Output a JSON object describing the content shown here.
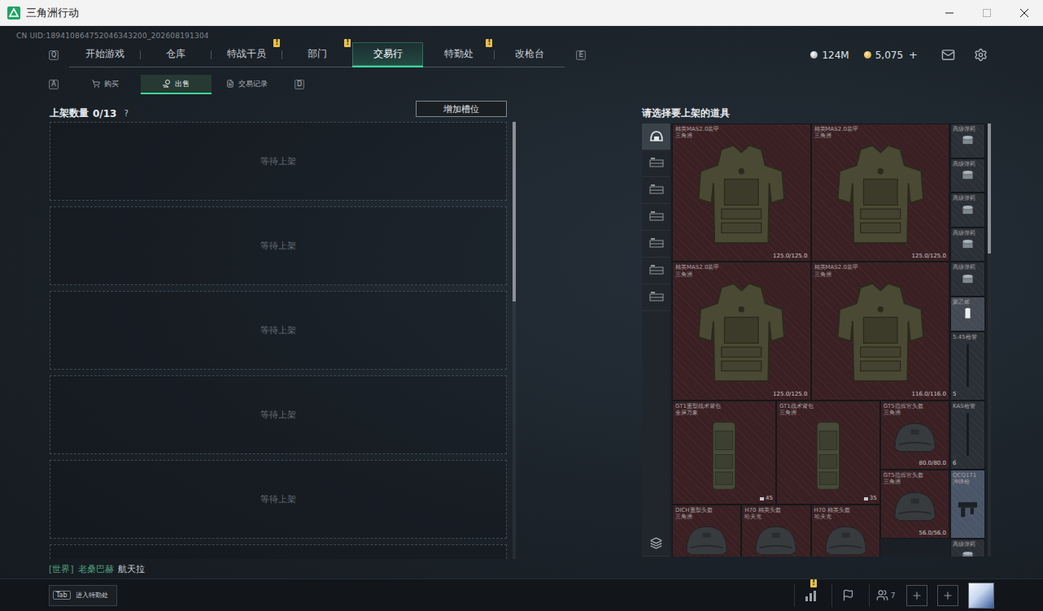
{
  "window": {
    "title": "三角洲行动",
    "controls": [
      {
        "kind": "minimize",
        "disabled": false
      },
      {
        "kind": "maximize",
        "disabled": true
      },
      {
        "kind": "close",
        "disabled": false
      }
    ]
  },
  "uid": "CN UID:189410864752046343200_202608191304",
  "nav": {
    "prev_key": "Q",
    "next_key": "E",
    "tabs": [
      {
        "label": "开始游戏",
        "selected": false,
        "badge": ""
      },
      {
        "label": "仓库",
        "selected": false,
        "badge": ""
      },
      {
        "label": "特战干员",
        "selected": false,
        "badge": "!"
      },
      {
        "label": "部门",
        "selected": false,
        "badge": "!"
      },
      {
        "label": "交易行",
        "selected": true,
        "badge": ""
      },
      {
        "label": "特勤处",
        "selected": false,
        "badge": "!"
      },
      {
        "label": "改枪台",
        "selected": false,
        "badge": ""
      }
    ]
  },
  "currency": [
    {
      "kind": "silver",
      "amount": "124M",
      "add": ""
    },
    {
      "kind": "gold",
      "amount": "5,075",
      "add": "+"
    }
  ],
  "subnav": {
    "prev_key": "A",
    "next_key": "D",
    "tabs": [
      {
        "label": "购买",
        "selected": false,
        "kind": "buy"
      },
      {
        "label": "出售",
        "selected": true,
        "kind": "sell"
      },
      {
        "label": "交易记录",
        "selected": false,
        "kind": "record"
      }
    ]
  },
  "listing": {
    "title": "上架数量",
    "count": "0/13",
    "help": "?",
    "add_slot_button": "增加槽位",
    "scroll": {
      "level": 0.41
    },
    "slots": [
      {
        "label": "等待上架"
      },
      {
        "label": "等待上架"
      },
      {
        "label": "等待上架"
      },
      {
        "label": "等待上架"
      },
      {
        "label": "等待上架"
      },
      {
        "label": ""
      }
    ]
  },
  "inventory": {
    "title": "请选择要上架的道具",
    "scroll": {
      "level": 0.3
    },
    "categories": [
      {
        "kind": "all",
        "selected": true
      },
      {
        "kind": "tier",
        "selected": false
      },
      {
        "kind": "tier",
        "selected": false
      },
      {
        "kind": "tier",
        "selected": false
      },
      {
        "kind": "tier",
        "selected": false
      },
      {
        "kind": "tier",
        "selected": false
      },
      {
        "kind": "tier",
        "selected": false
      }
    ],
    "items": [
      {
        "kind": "armor",
        "name": "精英MAS2.0装甲",
        "sub": "三角洲",
        "durability": "125.0/125.0",
        "count": "",
        "color": "#3a1f23"
      },
      {
        "kind": "armor",
        "name": "精英MAS2.0装甲",
        "sub": "三角洲",
        "durability": "125.0/125.0",
        "count": "",
        "color": "#3a1f23"
      },
      {
        "kind": "armor",
        "name": "精英MAS2.0装甲",
        "sub": "三角洲",
        "durability": "125.0/125.0",
        "count": "",
        "color": "#3a1f23"
      },
      {
        "kind": "armor",
        "name": "精英MAS2.0装甲",
        "sub": "三角洲",
        "durability": "116.0/116.0",
        "count": "",
        "color": "#3a1f23"
      },
      {
        "kind": "backpack",
        "name": "GT1重型战术背包",
        "sub": "全屏万象",
        "durability": "",
        "count": "45",
        "color": "#3a1f23"
      },
      {
        "kind": "backpack",
        "name": "GT1战术背包",
        "sub": "三角洲",
        "durability": "",
        "count": "35",
        "color": "#3a1f23"
      },
      {
        "kind": "helmet",
        "name": "GT5指挥官头盔",
        "sub": "三角洲",
        "durability": "80.0/80.0",
        "count": "",
        "color": "#3a1f23"
      },
      {
        "kind": "helmet",
        "name": "GT5指挥官头盔",
        "sub": "三角洲",
        "durability": "56.0/56.0",
        "count": "",
        "color": "#3a1f23"
      },
      {
        "kind": "helmet",
        "name": "DICH重型头盔",
        "sub": "三角洲",
        "durability": "",
        "count": "",
        "color": "#3a1f23"
      },
      {
        "kind": "helmet",
        "name": "H70 精英头盔",
        "sub": "哈夫克",
        "durability": "",
        "count": "",
        "color": "#3a1f23"
      },
      {
        "kind": "helmet",
        "name": "H70 精英头盔",
        "sub": "哈夫克",
        "durability": "",
        "count": "",
        "color": "#3a1f23"
      }
    ],
    "side_items": [
      {
        "kind": "ammo",
        "name": "高级弹药",
        "sub": "",
        "count": "",
        "color": "#2b3037"
      },
      {
        "kind": "ammo",
        "name": "高级弹药",
        "sub": "",
        "count": "",
        "color": "#2b3037"
      },
      {
        "kind": "ammo",
        "name": "高级弹药",
        "sub": "",
        "count": "",
        "color": "#2b3037"
      },
      {
        "kind": "ammo",
        "name": "高级弹药",
        "sub": "",
        "count": "",
        "color": "#2b3037"
      },
      {
        "kind": "ammo",
        "name": "高级弹药",
        "sub": "",
        "count": "",
        "color": "#2b3037"
      },
      {
        "kind": "canister",
        "name": "聚乙烯",
        "sub": "",
        "count": "",
        "color": "#434a54"
      },
      {
        "kind": "part",
        "name": "5.45枪管",
        "sub": "",
        "count": "5",
        "color": "#2b3037"
      },
      {
        "kind": "part",
        "name": "KAS枪管",
        "sub": "",
        "count": "6",
        "color": "#2b3037"
      },
      {
        "kind": "weapon",
        "name": "QCQ171",
        "sub": "冲锋枪",
        "count": "",
        "color": "#4a5568"
      },
      {
        "kind": "ammo",
        "name": "高级弹药",
        "sub": "",
        "count": "",
        "color": "#2b3037"
      }
    ]
  },
  "chat": {
    "channel": "[世界]",
    "sender": "老桑巴赫",
    "message": "航天拉"
  },
  "hint": {
    "key": "Tab",
    "label": "进入特勤处"
  },
  "dock": [
    {
      "kind": "stats",
      "badge": "!",
      "count": ""
    },
    {
      "kind": "flag",
      "badge": "",
      "count": ""
    },
    {
      "kind": "friends",
      "badge": "",
      "count": "7"
    },
    {
      "kind": "add",
      "badge": "",
      "count": ""
    },
    {
      "kind": "add",
      "badge": "",
      "count": ""
    },
    {
      "kind": "avatar",
      "badge": "",
      "count": ""
    }
  ]
}
